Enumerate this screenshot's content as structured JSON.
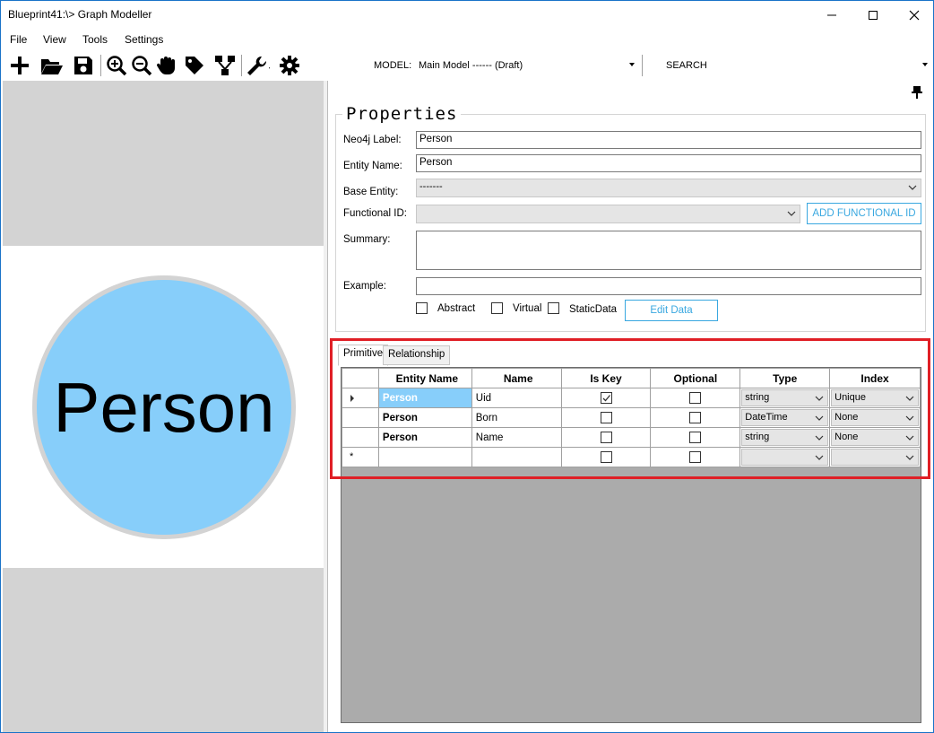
{
  "window": {
    "title": "Blueprint41:\\> Graph Modeller",
    "controls": [
      "minimize",
      "maximize",
      "close"
    ]
  },
  "menu": {
    "items": [
      "File",
      "View",
      "Tools",
      "Settings"
    ]
  },
  "toolbar": {
    "icons": [
      "add-icon",
      "open-folder-icon",
      "save-icon",
      "zoom-in-icon",
      "zoom-out-icon",
      "hand-icon",
      "tag-icon",
      "hierarchy-icon",
      "wrench-icon",
      "gear-icon"
    ],
    "model_label": "MODEL:",
    "model_value": "Main Model ------ (Draft)",
    "search_label": "SEARCH"
  },
  "canvas": {
    "node_label": "Person",
    "node_fill": "#87cefa"
  },
  "properties": {
    "title": "Properties",
    "neo4j_label": {
      "label": "Neo4j Label:",
      "value": "Person"
    },
    "entity_name": {
      "label": "Entity Name:",
      "value": "Person"
    },
    "base_entity": {
      "label": "Base Entity:",
      "value": "-------"
    },
    "functional_id": {
      "label": "Functional ID:",
      "value": ""
    },
    "add_functional_id_button": "ADD FUNCTIONAL ID",
    "summary": {
      "label": "Summary:",
      "value": ""
    },
    "example": {
      "label": "Example:",
      "value": ""
    },
    "abstract_label": "Abstract",
    "virtual_label": "Virtual",
    "staticdata_label": "StaticData",
    "edit_data_button": "Edit Data"
  },
  "tabs": {
    "primitive": "Primitive",
    "relationship": "Relationship"
  },
  "grid": {
    "columns": [
      "Entity Name",
      "Name",
      "Is Key",
      "Optional",
      "Type",
      "Index"
    ],
    "rows": [
      {
        "entity": "Person",
        "name": "Uid",
        "is_key": true,
        "optional": false,
        "type": "string",
        "index": "Unique",
        "selected": true
      },
      {
        "entity": "Person",
        "name": "Born",
        "is_key": false,
        "optional": false,
        "type": "DateTime",
        "index": "None",
        "selected": false
      },
      {
        "entity": "Person",
        "name": "Name",
        "is_key": false,
        "optional": false,
        "type": "string",
        "index": "None",
        "selected": false
      }
    ],
    "new_row_marker": "*"
  },
  "colors": {
    "accent": "#3aa8e0",
    "highlight_frame": "#e01f26",
    "selection": "#87cefa"
  }
}
